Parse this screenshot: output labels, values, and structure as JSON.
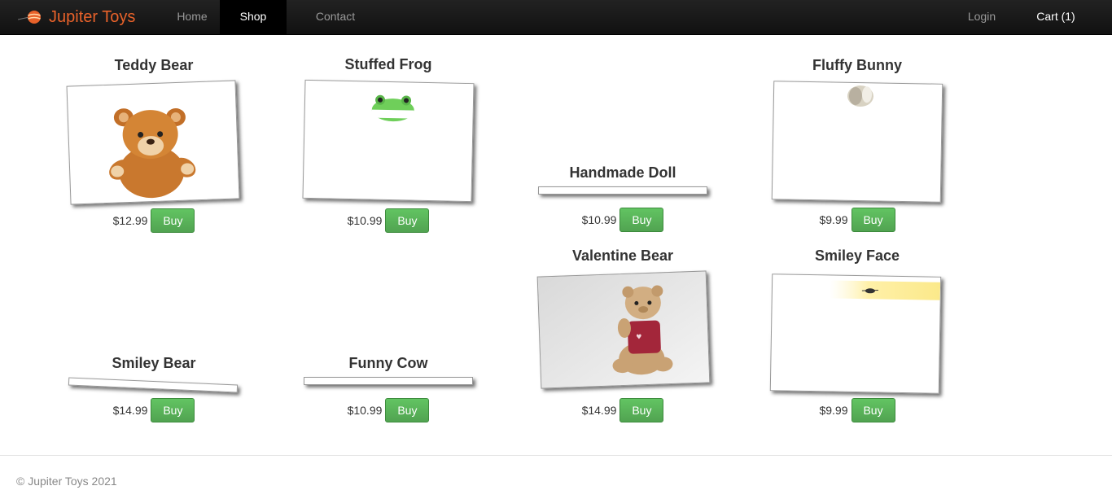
{
  "brand": {
    "name": "Jupiter Toys",
    "color": "#e8622a"
  },
  "nav": {
    "items": [
      {
        "label": "Home"
      },
      {
        "label": "Shop"
      },
      {
        "label": "Contact"
      }
    ],
    "active": "Shop",
    "login": "Login",
    "cart": "Cart (1)"
  },
  "products": [
    {
      "name": "Teddy Bear",
      "price": "$12.99",
      "buy": "Buy",
      "image": "teddy-bear-photo"
    },
    {
      "name": "Stuffed Frog",
      "price": "$10.99",
      "buy": "Buy",
      "image": "stuffed-frog-photo"
    },
    {
      "name": "Handmade Doll",
      "price": "$10.99",
      "buy": "Buy",
      "image": "handmade-doll-photo"
    },
    {
      "name": "Fluffy Bunny",
      "price": "$9.99",
      "buy": "Buy",
      "image": "fluffy-bunny-photo"
    },
    {
      "name": "Smiley Bear",
      "price": "$14.99",
      "buy": "Buy",
      "image": "smiley-bear-photo"
    },
    {
      "name": "Funny Cow",
      "price": "$10.99",
      "buy": "Buy",
      "image": "funny-cow-photo"
    },
    {
      "name": "Valentine Bear",
      "price": "$14.99",
      "buy": "Buy",
      "image": "valentine-bear-photo"
    },
    {
      "name": "Smiley Face",
      "price": "$9.99",
      "buy": "Buy",
      "image": "smiley-face-photo"
    }
  ],
  "footer": {
    "text": "© Jupiter Toys 2021"
  },
  "colors": {
    "navbar": "#1b1b1b",
    "buy_button": "#5bb75b",
    "accent": "#e8622a"
  }
}
